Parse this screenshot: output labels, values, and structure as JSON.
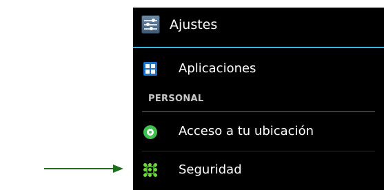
{
  "action_bar": {
    "title": "Ajustes",
    "app_icon": "settings-sliders-icon"
  },
  "list": {
    "items": [
      {
        "label": "Aplicaciones",
        "icon": "apps-grid-icon"
      }
    ],
    "section": {
      "header": "PERSONAL",
      "items": [
        {
          "label": "Acceso a tu ubicación",
          "icon": "location-icon"
        },
        {
          "label": "Seguridad",
          "icon": "security-pattern-icon"
        }
      ]
    }
  },
  "annotation": {
    "arrow_color": "#1f6e1f",
    "points_to": "Seguridad"
  },
  "colors": {
    "accent": "#33b5e5",
    "background": "#000000",
    "text": "#ffffff"
  }
}
